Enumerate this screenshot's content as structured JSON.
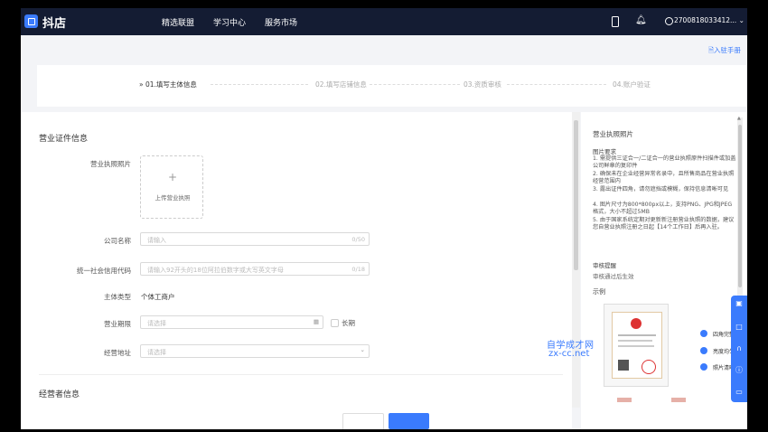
{
  "header": {
    "brand": "抖店",
    "nav": [
      "精选联盟",
      "学习中心",
      "服务市场"
    ],
    "account": "2700818033412..."
  },
  "guide_link": "入驻手册",
  "steps": [
    {
      "label": "01.填写主体信息",
      "active": true
    },
    {
      "label": "02.填写店铺信息",
      "active": false
    },
    {
      "label": "03.资质审核",
      "active": false
    },
    {
      "label": "04.账户验证",
      "active": false
    }
  ],
  "form": {
    "section_license": "营业证件信息",
    "license_photo_label": "营业执照照片",
    "upload_plus": "+",
    "upload_text": "上传营业执照",
    "company_name_label": "公司名称",
    "company_name_placeholder": "请输入",
    "company_name_count": "0/50",
    "credit_code_label": "统一社会信用代码",
    "credit_code_placeholder": "请输入92开头的18位阿拉伯数字或大写英文字母",
    "credit_code_count": "0/18",
    "entity_type_label": "主体类型",
    "entity_type_value": "个体工商户",
    "period_label": "营业期限",
    "period_placeholder": "请选择",
    "long_term_label": "长期",
    "address_label": "经营地址",
    "address_placeholder": "请选择",
    "section_operator": "经营者信息"
  },
  "side": {
    "title": "营业执照照片",
    "req_title": "图片要求",
    "requirements": [
      "1. 需提供三证合一/二证合一的营业执照原件扫描件或加盖公司鲜章的复印件",
      "2. 确保未在企业经营异常名录中，且所售商品在营业执照经营范围内",
      "3. 露出证件四角，请勿遮挡或模糊，保持信息清晰可见",
      "4. 图片尺寸为800*800px以上，支持PNG、JPG和JPEG格式，大小不超过5MB",
      "5. 由于国家系统定期对更新新注册营业执照的数据，建议您自营业执照注册之日起【14个工作日】后再入驻。"
    ],
    "review_title": "审核提醒",
    "review_text": "审核通过后生效",
    "example": "示例",
    "checks": [
      "四角完整",
      "亮度均匀",
      "照片清晰"
    ]
  },
  "watermark": {
    "line1": "自学成才网",
    "line2": "zx-cc.net"
  },
  "colors": {
    "accent": "#3a7bfd",
    "topbar": "#141c33"
  }
}
